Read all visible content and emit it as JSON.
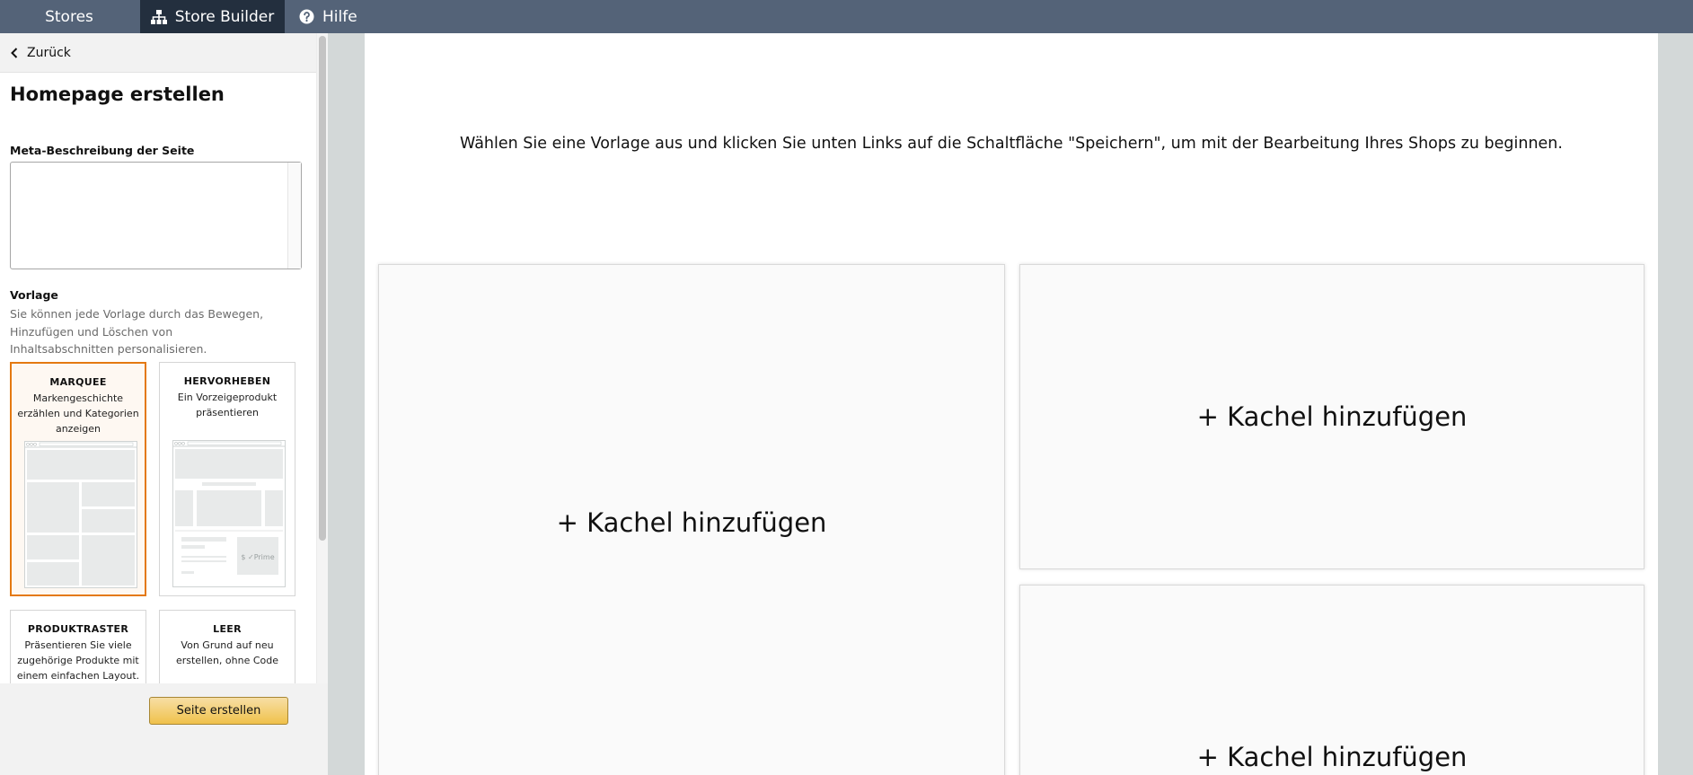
{
  "nav": {
    "stores": "Stores",
    "builder": "Store Builder",
    "help": "Hilfe"
  },
  "sidebar": {
    "back": "Zurück",
    "title": "Homepage erstellen",
    "meta_label": "Meta-Beschreibung der Seite",
    "meta_value": "",
    "vorlage_label": "Vorlage",
    "vorlage_desc": "Sie können jede Vorlage durch das Bewegen, Hinzufügen und Löschen von Inhaltsabschnitten personalisieren.",
    "templates": [
      {
        "name": "MARQUEE",
        "desc": "Markengeschichte erzählen und Kategorien anzeigen",
        "selected": true
      },
      {
        "name": "HERVORHEBEN",
        "desc": "Ein Vorzeigeprodukt präsentieren",
        "selected": false
      },
      {
        "name": "PRODUKTRASTER",
        "desc": "Präsentieren Sie viele zugehörige Produkte mit einem einfachen Layout.",
        "selected": false
      },
      {
        "name": "LEER",
        "desc": "Von Grund auf neu erstellen, ohne Code",
        "selected": false
      }
    ],
    "create_button": "Seite erstellen"
  },
  "canvas": {
    "instruction": "Wählen Sie eine Vorlage aus und klicken Sie unten Links auf die Schaltfläche \"Speichern\", um mit der Bearbeitung Ihres Shops zu beginnen.",
    "tiles": [
      {
        "label": "+ Kachel hinzufügen"
      },
      {
        "label": "+ Kachel hinzufügen"
      },
      {
        "label": "+ Kachel hinzufügen"
      }
    ]
  },
  "thumb_prime_label": "$ ✓Prime",
  "colors": {
    "nav_bg": "#546378",
    "nav_active_bg": "#232f3e",
    "selected_border": "#e47911",
    "button_yellow": "#f0c14b"
  }
}
